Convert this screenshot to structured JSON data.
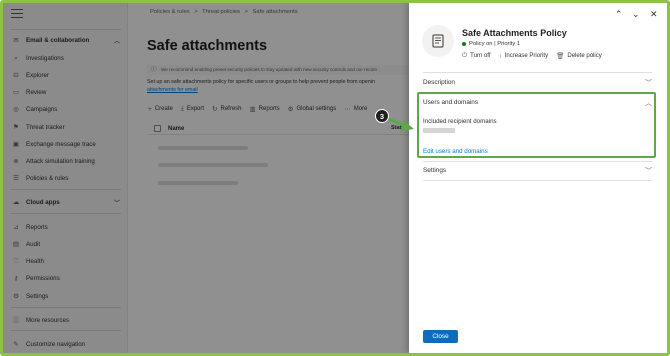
{
  "sidebar": {
    "items": [
      {
        "label": "Email & collaboration",
        "icon": "mail-icon",
        "head": true,
        "chevron": "up"
      },
      {
        "label": "Investigations",
        "icon": "investigation-icon"
      },
      {
        "label": "Explorer",
        "icon": "explorer-icon"
      },
      {
        "label": "Review",
        "icon": "review-icon"
      },
      {
        "label": "Campaigns",
        "icon": "campaign-icon"
      },
      {
        "label": "Threat tracker",
        "icon": "tracker-icon"
      },
      {
        "label": "Exchange message trace",
        "icon": "exchange-icon"
      },
      {
        "label": "Attack simulation training",
        "icon": "simulation-icon"
      },
      {
        "label": "Policies & rules",
        "icon": "policy-icon"
      },
      {
        "label": "Cloud apps",
        "icon": "cloud-icon",
        "head": true,
        "chevron": "down"
      },
      {
        "label": "Reports",
        "icon": "reports-icon"
      },
      {
        "label": "Audit",
        "icon": "audit-icon"
      },
      {
        "label": "Health",
        "icon": "health-icon"
      },
      {
        "label": "Permissions",
        "icon": "permissions-icon"
      },
      {
        "label": "Settings",
        "icon": "settings-icon"
      },
      {
        "label": "More resources",
        "icon": "info-icon"
      },
      {
        "label": "Customize navigation",
        "icon": "edit-icon"
      }
    ]
  },
  "main": {
    "breadcrumb": [
      "Policies & rules",
      ">",
      "Threat policies",
      ">",
      "Safe attachments"
    ],
    "title": "Safe attachments",
    "banner": "We recommend enabling preset security policies to stay updated with new security controls and our recom",
    "description": "Set up an safe attachments policy for specific users or groups to help prevent people from openin",
    "description_link": "attachments for email",
    "toolbar": [
      {
        "label": "Create",
        "icon": "plus-icon"
      },
      {
        "label": "Export",
        "icon": "export-icon"
      },
      {
        "label": "Refresh",
        "icon": "refresh-icon"
      },
      {
        "label": "Reports",
        "icon": "reports-icon"
      },
      {
        "label": "Global settings",
        "icon": "gear-icon"
      },
      {
        "label": "More",
        "icon": "more-icon"
      }
    ],
    "table": {
      "col_name": "Name",
      "col_status": "Status"
    }
  },
  "flyout": {
    "policy_name": "Safe Attachments Policy",
    "policy_status": "Policy on | Priority 1",
    "actions": [
      {
        "label": "Turn off",
        "icon": "power-icon"
      },
      {
        "label": "Increase Priority",
        "icon": "arrow-up-icon"
      },
      {
        "label": "Delete policy",
        "icon": "trash-icon"
      }
    ],
    "sections": {
      "description": "Description",
      "users_domains": "Users and domains",
      "settings": "Settings"
    },
    "included_label": "Included recipient domains",
    "edit_link": "Edit users and domains",
    "close_label": "Close"
  },
  "callout": {
    "step": "3"
  },
  "colors": {
    "accent": "#0f6cbd",
    "highlight": "#5fa84a",
    "status_on": "#107c10",
    "link": "#0078d4"
  }
}
